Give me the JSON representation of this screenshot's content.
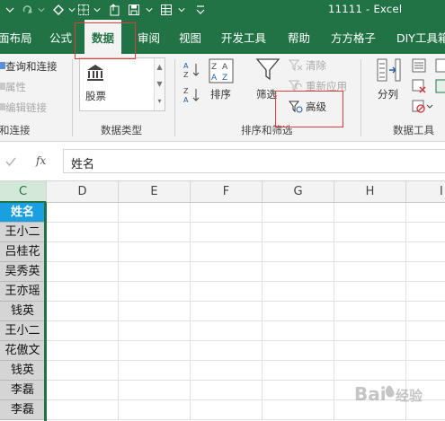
{
  "title_bar": {
    "doc_title": "11111 - Excel",
    "quick_access_icons": [
      "redo-icon",
      "format-painter-icon",
      "border-icon",
      "export-icon",
      "save-icon",
      "dropdown-icon",
      "table-icon",
      "dropdown-icon"
    ]
  },
  "tabs": [
    {
      "label": "面布局",
      "active": false
    },
    {
      "label": "公式",
      "active": false
    },
    {
      "label": "数据",
      "active": true
    },
    {
      "label": "审阅",
      "active": false
    },
    {
      "label": "视图",
      "active": false
    },
    {
      "label": "开发工具",
      "active": false
    },
    {
      "label": "帮助",
      "active": false
    },
    {
      "label": "方方格子",
      "active": false
    },
    {
      "label": "DIY工具箱",
      "active": false
    }
  ],
  "ribbon": {
    "connections": {
      "query": "查询和连接",
      "properties": "属性",
      "edit_links": "编辑链接",
      "group_label": "和连接"
    },
    "data_types": {
      "stock": "股票",
      "group_label": "数据类型"
    },
    "sort_filter": {
      "sort": "排序",
      "filter": "筛选",
      "clear": "清除",
      "reapply": "重新应用",
      "advanced": "高级",
      "group_label": "排序和筛选"
    },
    "data_tools": {
      "split": "分列",
      "group_label": "数据工具"
    }
  },
  "formula_bar": {
    "fx": "fx",
    "value": "姓名"
  },
  "grid": {
    "columns": [
      "C",
      "D",
      "E",
      "F",
      "G",
      "H",
      "I"
    ],
    "selected_column": "C",
    "column_c_values": [
      "姓名",
      "王小二",
      "吕桂花",
      "吴秀英",
      "王亦瑶",
      "钱英",
      "王小二",
      "花傲文",
      "钱英",
      "李磊",
      "李磊"
    ]
  },
  "watermark": "Baidu 经验",
  "colors": {
    "excel_green": "#217346",
    "header_blue": "#1aa0e0",
    "highlight_red": "#e03a3a"
  }
}
